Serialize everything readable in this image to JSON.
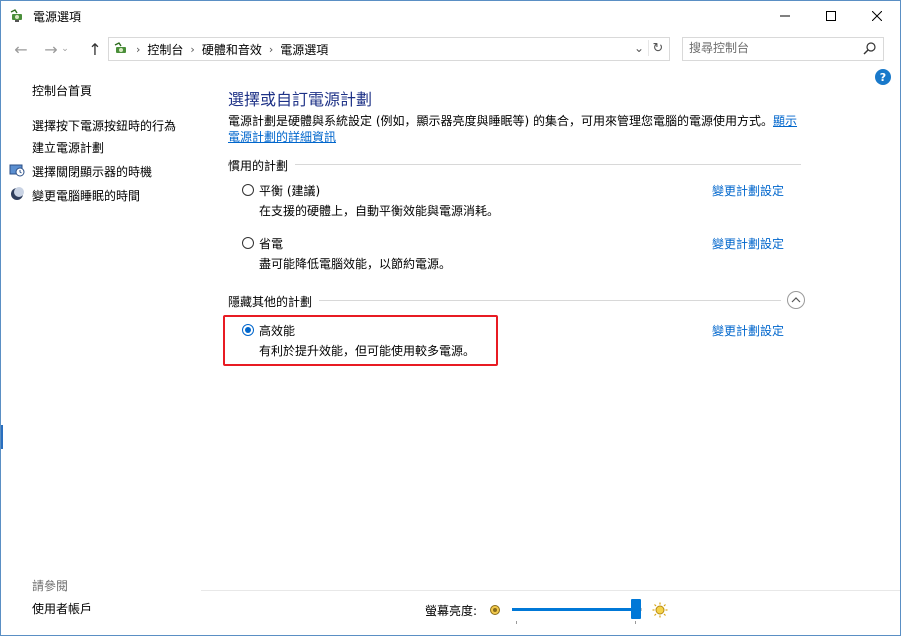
{
  "window": {
    "title": "電源選項"
  },
  "address": {
    "crumbs": [
      "控制台",
      "硬體和音效",
      "電源選項"
    ],
    "search_placeholder": "搜尋控制台"
  },
  "sidebar": {
    "home": "控制台首頁",
    "links": [
      "選擇按下電源按鈕時的行為",
      "建立電源計劃",
      "選擇關閉顯示器的時機",
      "變更電腦睡眠的時間"
    ],
    "see_also": "請參閱",
    "user_accounts": "使用者帳戶"
  },
  "main": {
    "title": "選擇或自訂電源計劃",
    "description": "電源計劃是硬體與系統設定 (例如，顯示器亮度與睡眠等) 的集合，可用來管理您電腦的電源使用方式。",
    "description_link": "顯示電源計劃的詳細資訊",
    "preferred_header": "慣用的計劃",
    "hidden_header": "隱藏其他的計劃",
    "change_link": "變更計劃設定",
    "plans": [
      {
        "name": "平衡 (建議)",
        "desc": "在支援的硬體上，自動平衡效能與電源消耗。",
        "selected": false
      },
      {
        "name": "省電",
        "desc": "盡可能降低電腦效能，以節約電源。",
        "selected": false
      },
      {
        "name": "高效能",
        "desc": "有利於提升效能，但可能使用較多電源。",
        "selected": true
      }
    ]
  },
  "brightness": {
    "label": "螢幕亮度:",
    "level_fraction": 0.95
  },
  "colors": {
    "link": "#0066cc",
    "title": "#1e3287",
    "highlight": "#e81b23",
    "accent": "#0078d7"
  },
  "icons": [
    "power-options-icon",
    "back-arrow-icon",
    "forward-arrow-icon",
    "up-arrow-icon",
    "search-icon",
    "help-icon",
    "refresh-icon",
    "collapse-icon",
    "monitor-clock-icon",
    "moon-icon",
    "brightness-dim-icon",
    "brightness-full-icon"
  ]
}
